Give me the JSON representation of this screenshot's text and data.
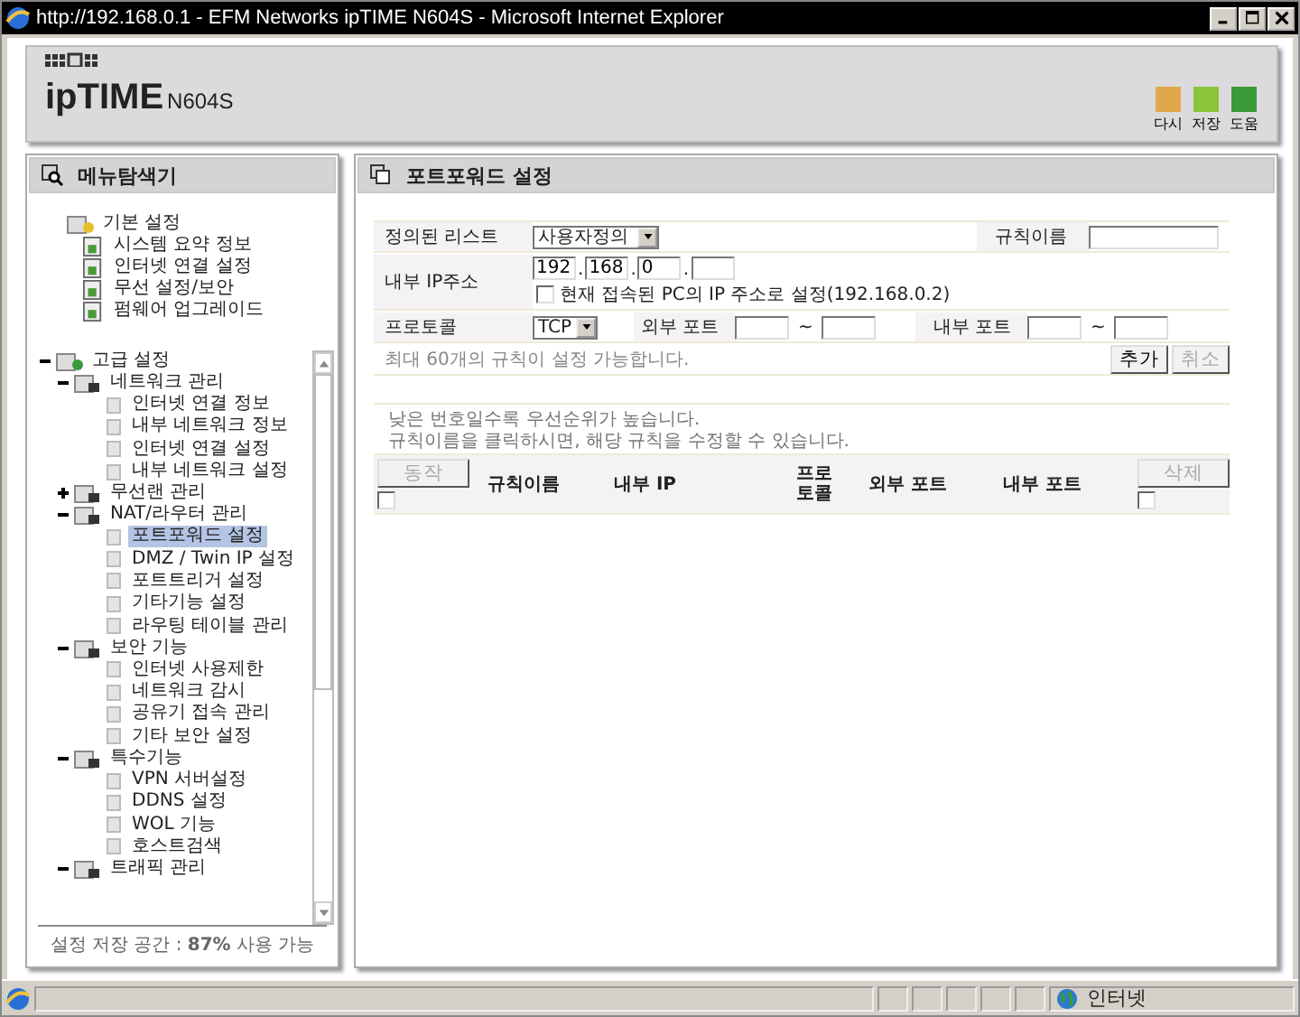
{
  "window": {
    "title": "http://192.168.0.1 - EFM Networks ipTIME N604S - Microsoft Internet Explorer"
  },
  "header": {
    "brand": "ipTIME",
    "model": "N604S",
    "tools": [
      {
        "label": "다시",
        "color": "#e0a84a"
      },
      {
        "label": "저장",
        "color": "#8cc43c"
      },
      {
        "label": "도움",
        "color": "#3a9a3a"
      }
    ]
  },
  "sidebar": {
    "title": "메뉴탐색기",
    "basic": {
      "label": "기본 설정",
      "children": [
        {
          "label": "시스템 요약 정보"
        },
        {
          "label": "인터넷 연결 설정"
        },
        {
          "label": "무선 설정/보안"
        },
        {
          "label": "펌웨어 업그레이드"
        }
      ]
    },
    "advanced": {
      "label": "고급 설정",
      "expanded": true,
      "children": [
        {
          "label": "네트워크 관리",
          "expanded": true,
          "children": [
            {
              "label": "인터넷 연결 정보",
              "selected": false
            },
            {
              "label": "내부 네트워크 정보",
              "selected": false
            },
            {
              "label": "인터넷 연결 설정",
              "selected": false
            },
            {
              "label": "내부 네트워크 설정",
              "selected": false
            }
          ]
        },
        {
          "label": "무선랜 관리",
          "expanded": false
        },
        {
          "label": "NAT/라우터 관리",
          "expanded": true,
          "children": [
            {
              "label": "포트포워드 설정",
              "selected": true
            },
            {
              "label": "DMZ / Twin IP 설정",
              "selected": false
            },
            {
              "label": "포트트리거 설정",
              "selected": false
            },
            {
              "label": "기타기능 설정",
              "selected": false
            },
            {
              "label": "라우팅 테이블 관리",
              "selected": false
            }
          ]
        },
        {
          "label": "보안 기능",
          "expanded": true,
          "children": [
            {
              "label": "인터넷 사용제한",
              "selected": false
            },
            {
              "label": "네트워크 감시",
              "selected": false
            },
            {
              "label": "공유기 접속 관리",
              "selected": false
            },
            {
              "label": "기타 보안 설정",
              "selected": false
            }
          ]
        },
        {
          "label": "특수기능",
          "expanded": true,
          "children": [
            {
              "label": "VPN 서버설정",
              "selected": false
            },
            {
              "label": "DDNS 설정",
              "selected": false
            },
            {
              "label": "WOL 기능",
              "selected": false
            },
            {
              "label": "호스트검색",
              "selected": false
            }
          ]
        },
        {
          "label": "트래픽 관리",
          "expanded": true
        }
      ]
    },
    "footer": "설정 저장 공간 : **87%** 사용 가능"
  },
  "main": {
    "title": "포트포워드 설정",
    "form": {
      "list_label": "정의된 리스트",
      "list_value": "사용자정의",
      "rule_name_label": "규칙이름",
      "ip_label": "내부 IP주소",
      "ip": [
        "192",
        "168",
        "0"
      ],
      "ip_separator": ".",
      "current_pc": {
        "label": "현재 접속된 PC의 IP 주소로 설정(192.168.0.2)",
        "checked": false
      },
      "protocol_label": "프로토콜",
      "protocol": "TCP",
      "ext_port_label": "외부 포트",
      "int_port_label": "내부 포트",
      "tilde": "~",
      "note": "최대 60개의 규칙이 설정 가능합니다.",
      "add": {
        "label": "추가",
        "disabled": false
      },
      "cancel": {
        "label": "취소",
        "disabled": true
      }
    },
    "hints": [
      "낮은 번호일수록 우선순위가 높습니다.",
      "규칙이름을 클릭하시면, 해당 규칙을 수정할 수 있습니다."
    ],
    "table": {
      "action": {
        "label": "동작",
        "disabled": true
      },
      "action_checked": false,
      "columns": [
        "규칙이름",
        "내부 IP",
        "프로\n토콜",
        "외부 포트",
        "내부 포트"
      ],
      "delete": {
        "label": "삭제",
        "disabled": true
      },
      "delete_checked": false
    }
  },
  "status_bar": {
    "zone": "인터넷"
  }
}
